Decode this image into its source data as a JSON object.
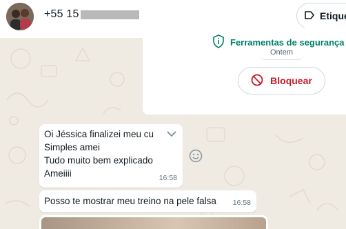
{
  "header": {
    "contact_name": "+55 15",
    "label_button": "Etique"
  },
  "security": {
    "title": "Ferramentas de segurança",
    "date_chip": "Ontem",
    "block_button": "Bloquear"
  },
  "messages": [
    {
      "lines": [
        "Oi Jéssica finalizei meu cu",
        "Simples amei",
        "Tudo muito bem explicado",
        "Ameiiii"
      ],
      "time": "16:58"
    },
    {
      "text": "Posso te mostrar meu treino na pele falsa",
      "time": "16:58"
    }
  ],
  "colors": {
    "accent_green": "#008069",
    "danger_red": "#c41a24",
    "wallpaper": "#efeae2"
  },
  "icons": [
    "shield-icon",
    "block-icon",
    "label-icon",
    "chevron-down-icon",
    "emoji-icon"
  ]
}
